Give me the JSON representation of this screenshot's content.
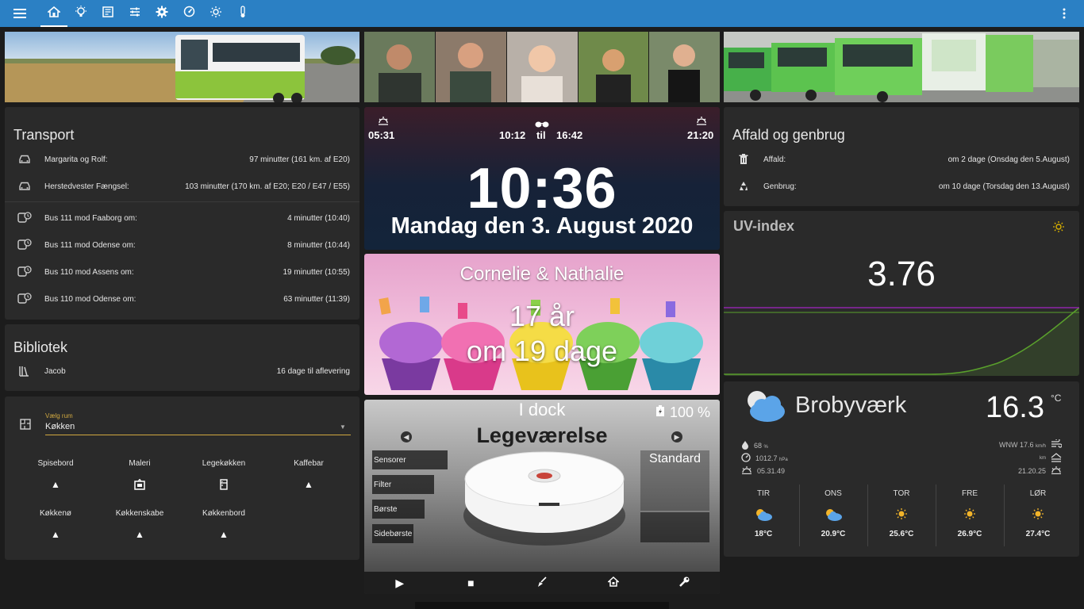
{
  "topbar": {
    "menu_icon": "menu-icon",
    "tabs": [
      "home-icon",
      "lightbulb-icon",
      "newspaper-icon",
      "tune-icon",
      "gear-icon",
      "gauge-icon",
      "sun-icon",
      "thermometer-icon"
    ],
    "more_icon": "dots-vertical-icon"
  },
  "transport": {
    "title": "Transport",
    "cars": [
      {
        "label": "Margarita og Rolf:",
        "value": "97 minutter (161 km. af E20)"
      },
      {
        "label": "Herstedvester Fængsel:",
        "value": "103 minutter (170 km. af E20; E20 / E47 / E55)"
      }
    ],
    "buses": [
      {
        "label": "Bus 111 mod Faaborg om:",
        "value": "4 minutter (10:40)"
      },
      {
        "label": "Bus 111 mod Odense om:",
        "value": "8 minutter (10:44)"
      },
      {
        "label": "Bus 110 mod Assens om:",
        "value": "19 minutter (10:55)"
      },
      {
        "label": "Bus 110 mod Odense om:",
        "value": "63 minutter (11:39)"
      }
    ]
  },
  "library": {
    "title": "Bibliotek",
    "label": "Jacob",
    "value": "16 dage til aflevering"
  },
  "rooms": {
    "select_label": "Vælg rum",
    "select_value": "Køkken",
    "tiles": [
      {
        "label": "Spisebord",
        "icon": "ceiling-light-icon"
      },
      {
        "label": "Maleri",
        "icon": "painting-icon"
      },
      {
        "label": "Legekøkken",
        "icon": "fridge-icon"
      },
      {
        "label": "Kaffebar",
        "icon": "ceiling-light-icon"
      },
      {
        "label": "Køkkenø",
        "icon": "ceiling-light-icon"
      },
      {
        "label": "Køkkenskabe",
        "icon": "ceiling-light-icon"
      },
      {
        "label": "Køkkenbord",
        "icon": "ceiling-light-icon"
      }
    ]
  },
  "clock": {
    "sunrise": "05:31",
    "sun_from": "10:12",
    "sun_til": "til",
    "sun_to": "16:42",
    "sunset": "21:20",
    "time": "10:36",
    "date": "Mandag den 3. August 2020"
  },
  "birthday": {
    "names": "Cornelie & Nathalie",
    "age": "17 år",
    "days": "om 19 dage"
  },
  "vacuum": {
    "status": "I dock",
    "battery": "100 %",
    "room": "Legeværelse",
    "side_buttons": [
      "Sensorer",
      "Filter",
      "Børste",
      "Sidebørste"
    ],
    "mode": "Standard",
    "controls": [
      "play-icon",
      "stop-icon",
      "broom-icon",
      "home-dock-icon",
      "wrench-icon"
    ]
  },
  "waste": {
    "title": "Affald og genbrug",
    "rows": [
      {
        "label": "Affald:",
        "value": "om 2 dage (Onsdag den 5.August)",
        "icon": "trash-icon"
      },
      {
        "label": "Genbrug:",
        "value": "om 10 dage (Torsdag den 13.August)",
        "icon": "recycle-icon"
      }
    ]
  },
  "uv": {
    "title": "UV-index",
    "value": "3.76",
    "line_color": "#5aa02c",
    "threshold_color": "#8e24aa"
  },
  "weather": {
    "location": "Brobyværk",
    "temperature": "16.3",
    "unit": "°C",
    "humidity": "68",
    "humidity_unit": "%",
    "pressure": "1012.7",
    "pressure_unit": "hPa",
    "sunrise": "05.31.49",
    "wind": "WNW 17.6",
    "wind_unit": "km/h",
    "visibility_unit": "km",
    "sunset": "21.20.25",
    "forecast": [
      {
        "day": "TIR",
        "temp": "18°C",
        "icon": "partly-cloudy-icon"
      },
      {
        "day": "ONS",
        "temp": "20.9°C",
        "icon": "partly-cloudy-icon"
      },
      {
        "day": "TOR",
        "temp": "25.6°C",
        "icon": "sunny-icon"
      },
      {
        "day": "FRE",
        "temp": "26.9°C",
        "icon": "sunny-icon"
      },
      {
        "day": "LØR",
        "temp": "27.4°C",
        "icon": "sunny-icon"
      }
    ]
  }
}
